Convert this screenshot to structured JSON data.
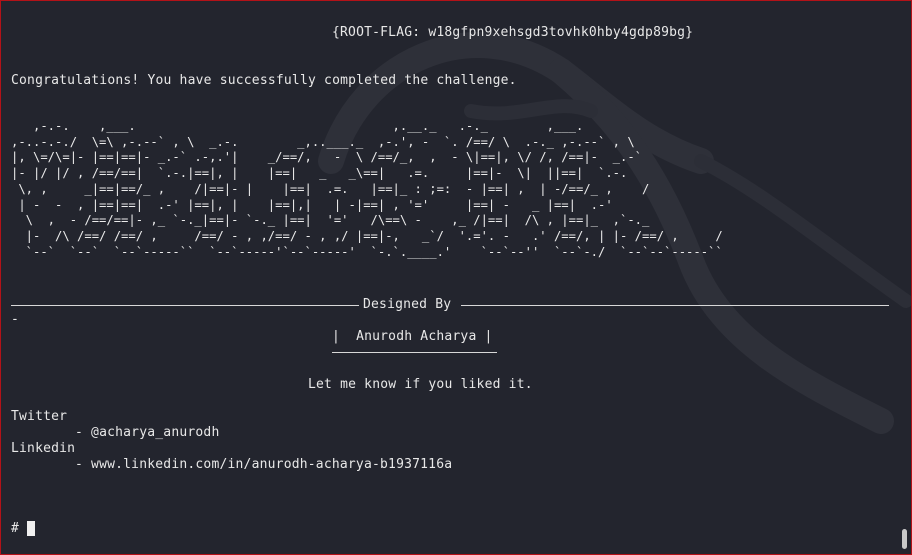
{
  "terminal": {
    "flag_line": "{ROOT-FLAG: w18gfpn9xehsgd3tovhk0hby4gdp89bg}",
    "congrats": "Congratulations! You have successfully completed the challenge.",
    "ascii_art": "   ,-.-.    ,___.                                   ,.__._   .-._        ,___.\n,-..-.-./  \\=\\ ,-.--` , \\  _.-.        _,..___._  ,-.', -  `. /==/ \\  .-._ ,-.--` , \\\n|, \\=/\\=|- |==|==|- _.-` .-,.'|    _/==/,   -  \\ /==/_,  ,  - \\|==|, \\/ /, /==|-  _.-`\n|- |/ |/ , /==/==|  `.-.|==|, |    |==|   _   _\\==|   .=.     |==|-  \\|  ||==|  `.-.\n \\, ,     _|==|==/_ ,    /|==|- |    |==|  .=.   |==|_ : ;=:  - |==| ,  | -/==/_ ,    /\n | -  -  , |==|==|  .-' |==|, |    |==|,|   | -|==| , '='     |==| -   _ |==|  .-'\n  \\  ,  - /==/==|- ,_ `-._|==|- `-._ |==|  '='   /\\==\\ -    ,_ /|==|  /\\ , |==|_  ,`-._\n  |-  /\\ /==/ /==/ ,     /==/ - , ,/==/ - , ,/ |==|-,   _`/  '.='. -   .' /==/, | |- /==/ ,     /\n  `--`  `--`  `--`-----``  `--`-----'`--`-----'  `-.`.____.'    `--`--''  `--`-./  `--`--`-----``",
    "designed_by": "Designed By",
    "author": "|  Anurodh Acharya |",
    "feedback": "Let me know if you liked it.",
    "twitter_label": "Twitter",
    "twitter_handle": "- @acharya_anurodh",
    "linkedin_label": "Linkedin",
    "linkedin_url": "- www.linkedin.com/in/anurodh-acharya-b1937116a",
    "stray_dash": "-",
    "prompt": "#"
  },
  "colors": {
    "background": "#23252e",
    "text": "#e8e8e8",
    "border": "#b31218"
  }
}
